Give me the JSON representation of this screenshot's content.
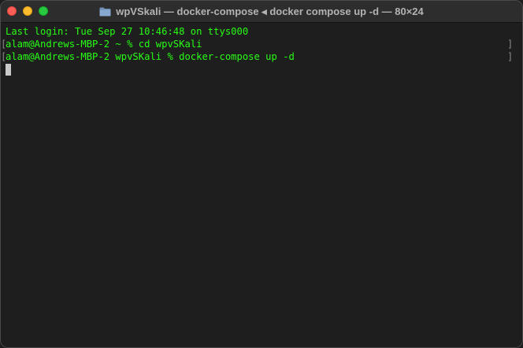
{
  "window": {
    "title": "wpVSkali — docker-compose ◂ docker compose up -d — 80×24",
    "icon": "folder-icon"
  },
  "terminal": {
    "lines": [
      "Last login: Tue Sep 27 10:46:48 on ttys000",
      "alam@Andrews-MBP-2 ~ % cd wpvSKali",
      "alam@Andrews-MBP-2 wpvSKali % docker-compose up -d"
    ],
    "mark_left": "[",
    "mark_right": "]"
  },
  "colors": {
    "text": "#28fe14",
    "background": "#1e1e1e",
    "titlebar": "#2d2d2d"
  }
}
